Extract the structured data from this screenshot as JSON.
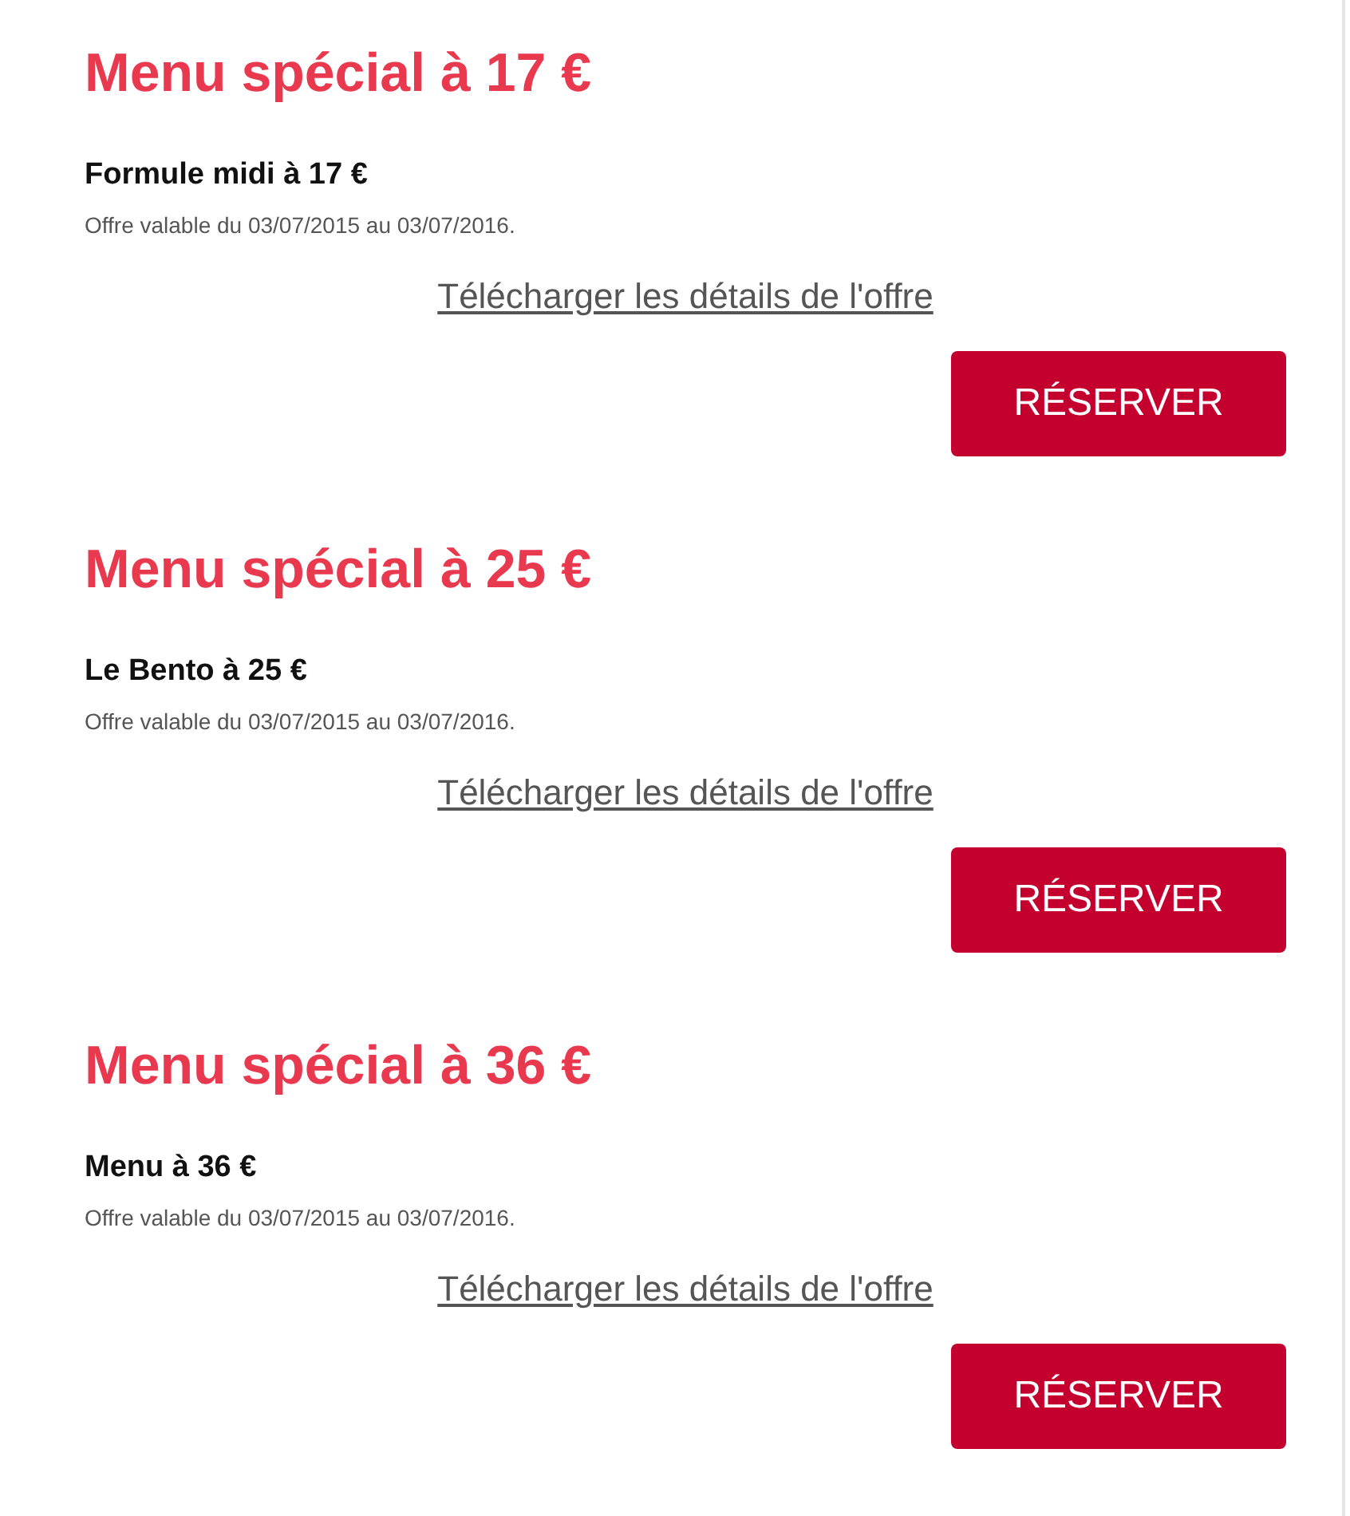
{
  "offers": [
    {
      "title": "Menu spécial à 17 €",
      "name": "Formule midi à 17 €",
      "validity": "Offre valable du 03/07/2015 au 03/07/2016.",
      "download_link": "Télécharger les détails de l'offre",
      "button": "RÉSERVER"
    },
    {
      "title": "Menu spécial à 25 €",
      "name": "Le Bento à 25 €",
      "validity": "Offre valable du 03/07/2015 au 03/07/2016.",
      "download_link": "Télécharger les détails de l'offre",
      "button": "RÉSERVER"
    },
    {
      "title": "Menu spécial à 36 €",
      "name": "Menu à 36 €",
      "validity": "Offre valable du 03/07/2015 au 03/07/2016.",
      "download_link": "Télécharger les détails de l'offre",
      "button": "RÉSERVER"
    }
  ]
}
